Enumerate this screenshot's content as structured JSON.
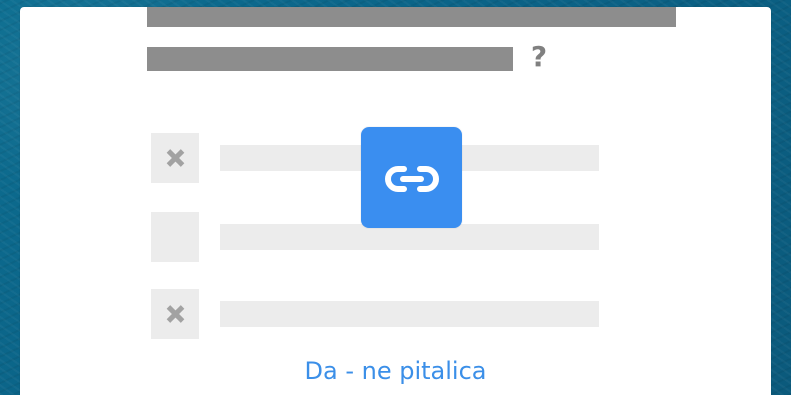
{
  "icons": {
    "close": "x-icon",
    "link": "link-icon",
    "question": "question-icon"
  },
  "colors": {
    "accent": "#3a8ef0",
    "link_text": "#3b8fe8"
  },
  "footer": {
    "label": "Da - ne pitalica"
  },
  "question_mark": "?"
}
